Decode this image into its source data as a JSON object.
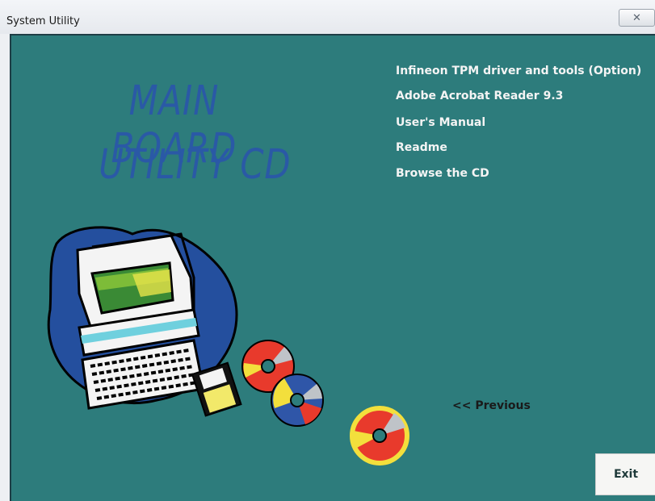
{
  "window": {
    "title": "System Utility"
  },
  "logo": {
    "line1": "MAIN BOARD",
    "line2": "UTILITY CD"
  },
  "menu": {
    "items": [
      {
        "label": "Infineon TPM driver and tools (Option)"
      },
      {
        "label": "Adobe Acrobat Reader 9.3"
      },
      {
        "label": "User's Manual"
      },
      {
        "label": "Readme"
      },
      {
        "label": "Browse the CD"
      }
    ]
  },
  "nav": {
    "previous_label": "<< Previous",
    "exit_label": "Exit"
  },
  "icons": {
    "close": "close-icon",
    "computer": "computer-illustration",
    "floppy": "floppy-disk-icon",
    "disc": "cd-disc-icon"
  },
  "colors": {
    "background": "#2d7c7c",
    "logo_text": "#2a59a6",
    "menu_text": "#f4f4f4"
  }
}
